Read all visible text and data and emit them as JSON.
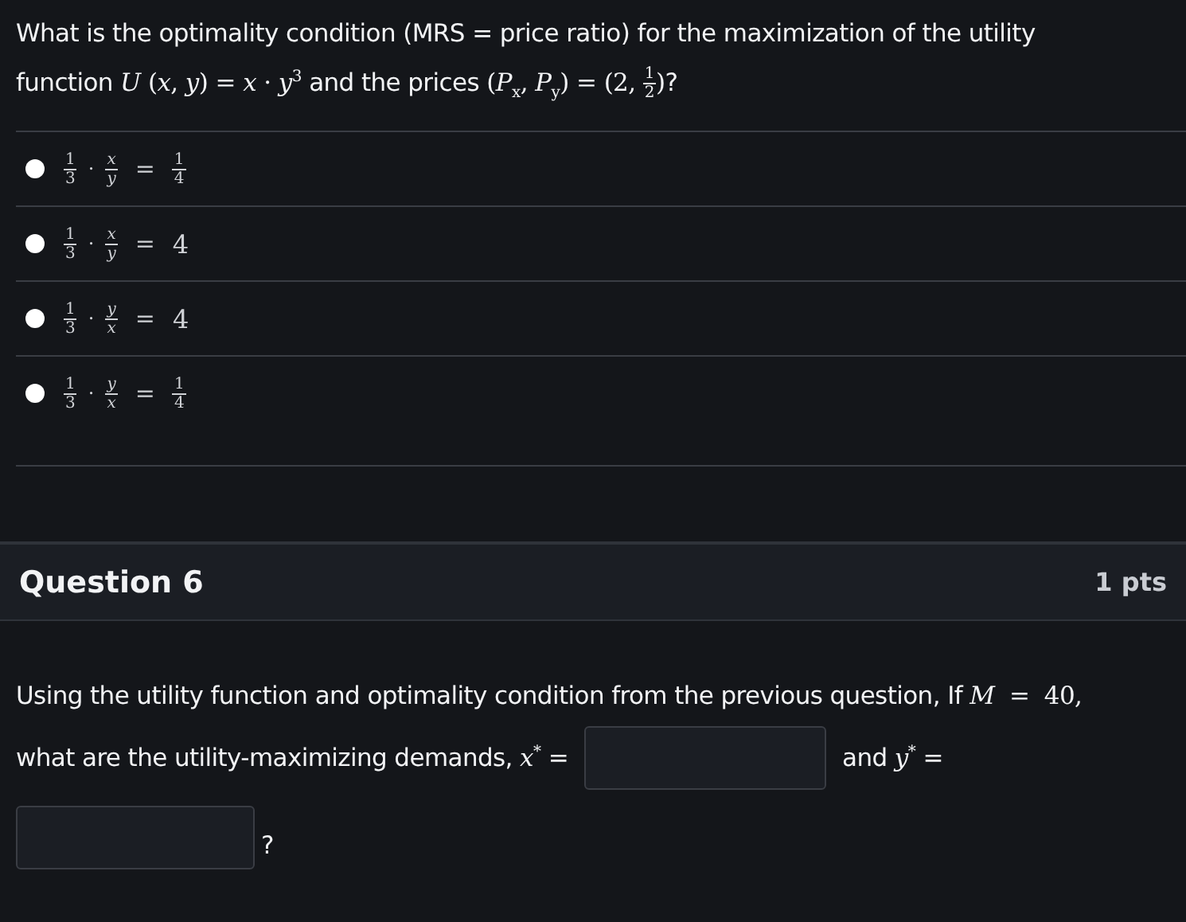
{
  "question5": {
    "prompt": [
      {
        "text": "What is the optimality condition (MRS = price ratio) for the maximization of the utility function "
      },
      {
        "math": "*U* (*x*, *y*) = *x* · *y*$^{3}$"
      },
      {
        "text": " and the prices "
      },
      {
        "math": "(*P*$_{x}$, *P*$_{y}$) = (2, "
      },
      {
        "frac": {
          "num": "1",
          "den": "2"
        }
      },
      {
        "math": ")"
      },
      {
        "text": "?"
      }
    ],
    "options": [
      {
        "selected": false,
        "coef": {
          "num": "1",
          "den": "3"
        },
        "dot": "·",
        "ratio": {
          "num": "x",
          "den": "y"
        },
        "eq": "=",
        "rhs": {
          "kind": "frac",
          "num": "1",
          "den": "4"
        }
      },
      {
        "selected": false,
        "coef": {
          "num": "1",
          "den": "3"
        },
        "dot": "·",
        "ratio": {
          "num": "x",
          "den": "y"
        },
        "eq": "=",
        "rhs": {
          "kind": "plain",
          "text": "4"
        }
      },
      {
        "selected": false,
        "coef": {
          "num": "1",
          "den": "3"
        },
        "dot": "·",
        "ratio": {
          "num": "y",
          "den": "x"
        },
        "eq": "=",
        "rhs": {
          "kind": "plain",
          "text": "4"
        }
      },
      {
        "selected": false,
        "coef": {
          "num": "1",
          "den": "3"
        },
        "dot": "·",
        "ratio": {
          "num": "y",
          "den": "x"
        },
        "eq": "=",
        "rhs": {
          "kind": "frac",
          "num": "1",
          "den": "4"
        }
      }
    ]
  },
  "question6": {
    "title": "Question 6",
    "points": "1 pts",
    "line1": [
      {
        "text": "Using the utility function and optimality condition from the previous question, If "
      },
      {
        "math": "*M*  =  40,"
      }
    ],
    "line2_lead": [
      {
        "text": "what are the utility-maximizing demands, "
      },
      {
        "math": "*x*$^{*}$"
      },
      {
        "text": " ="
      }
    ],
    "line2_mid": [
      {
        "text": "and "
      },
      {
        "math": "*y*$^{*}$"
      },
      {
        "text": " ="
      }
    ],
    "tail": "?"
  }
}
